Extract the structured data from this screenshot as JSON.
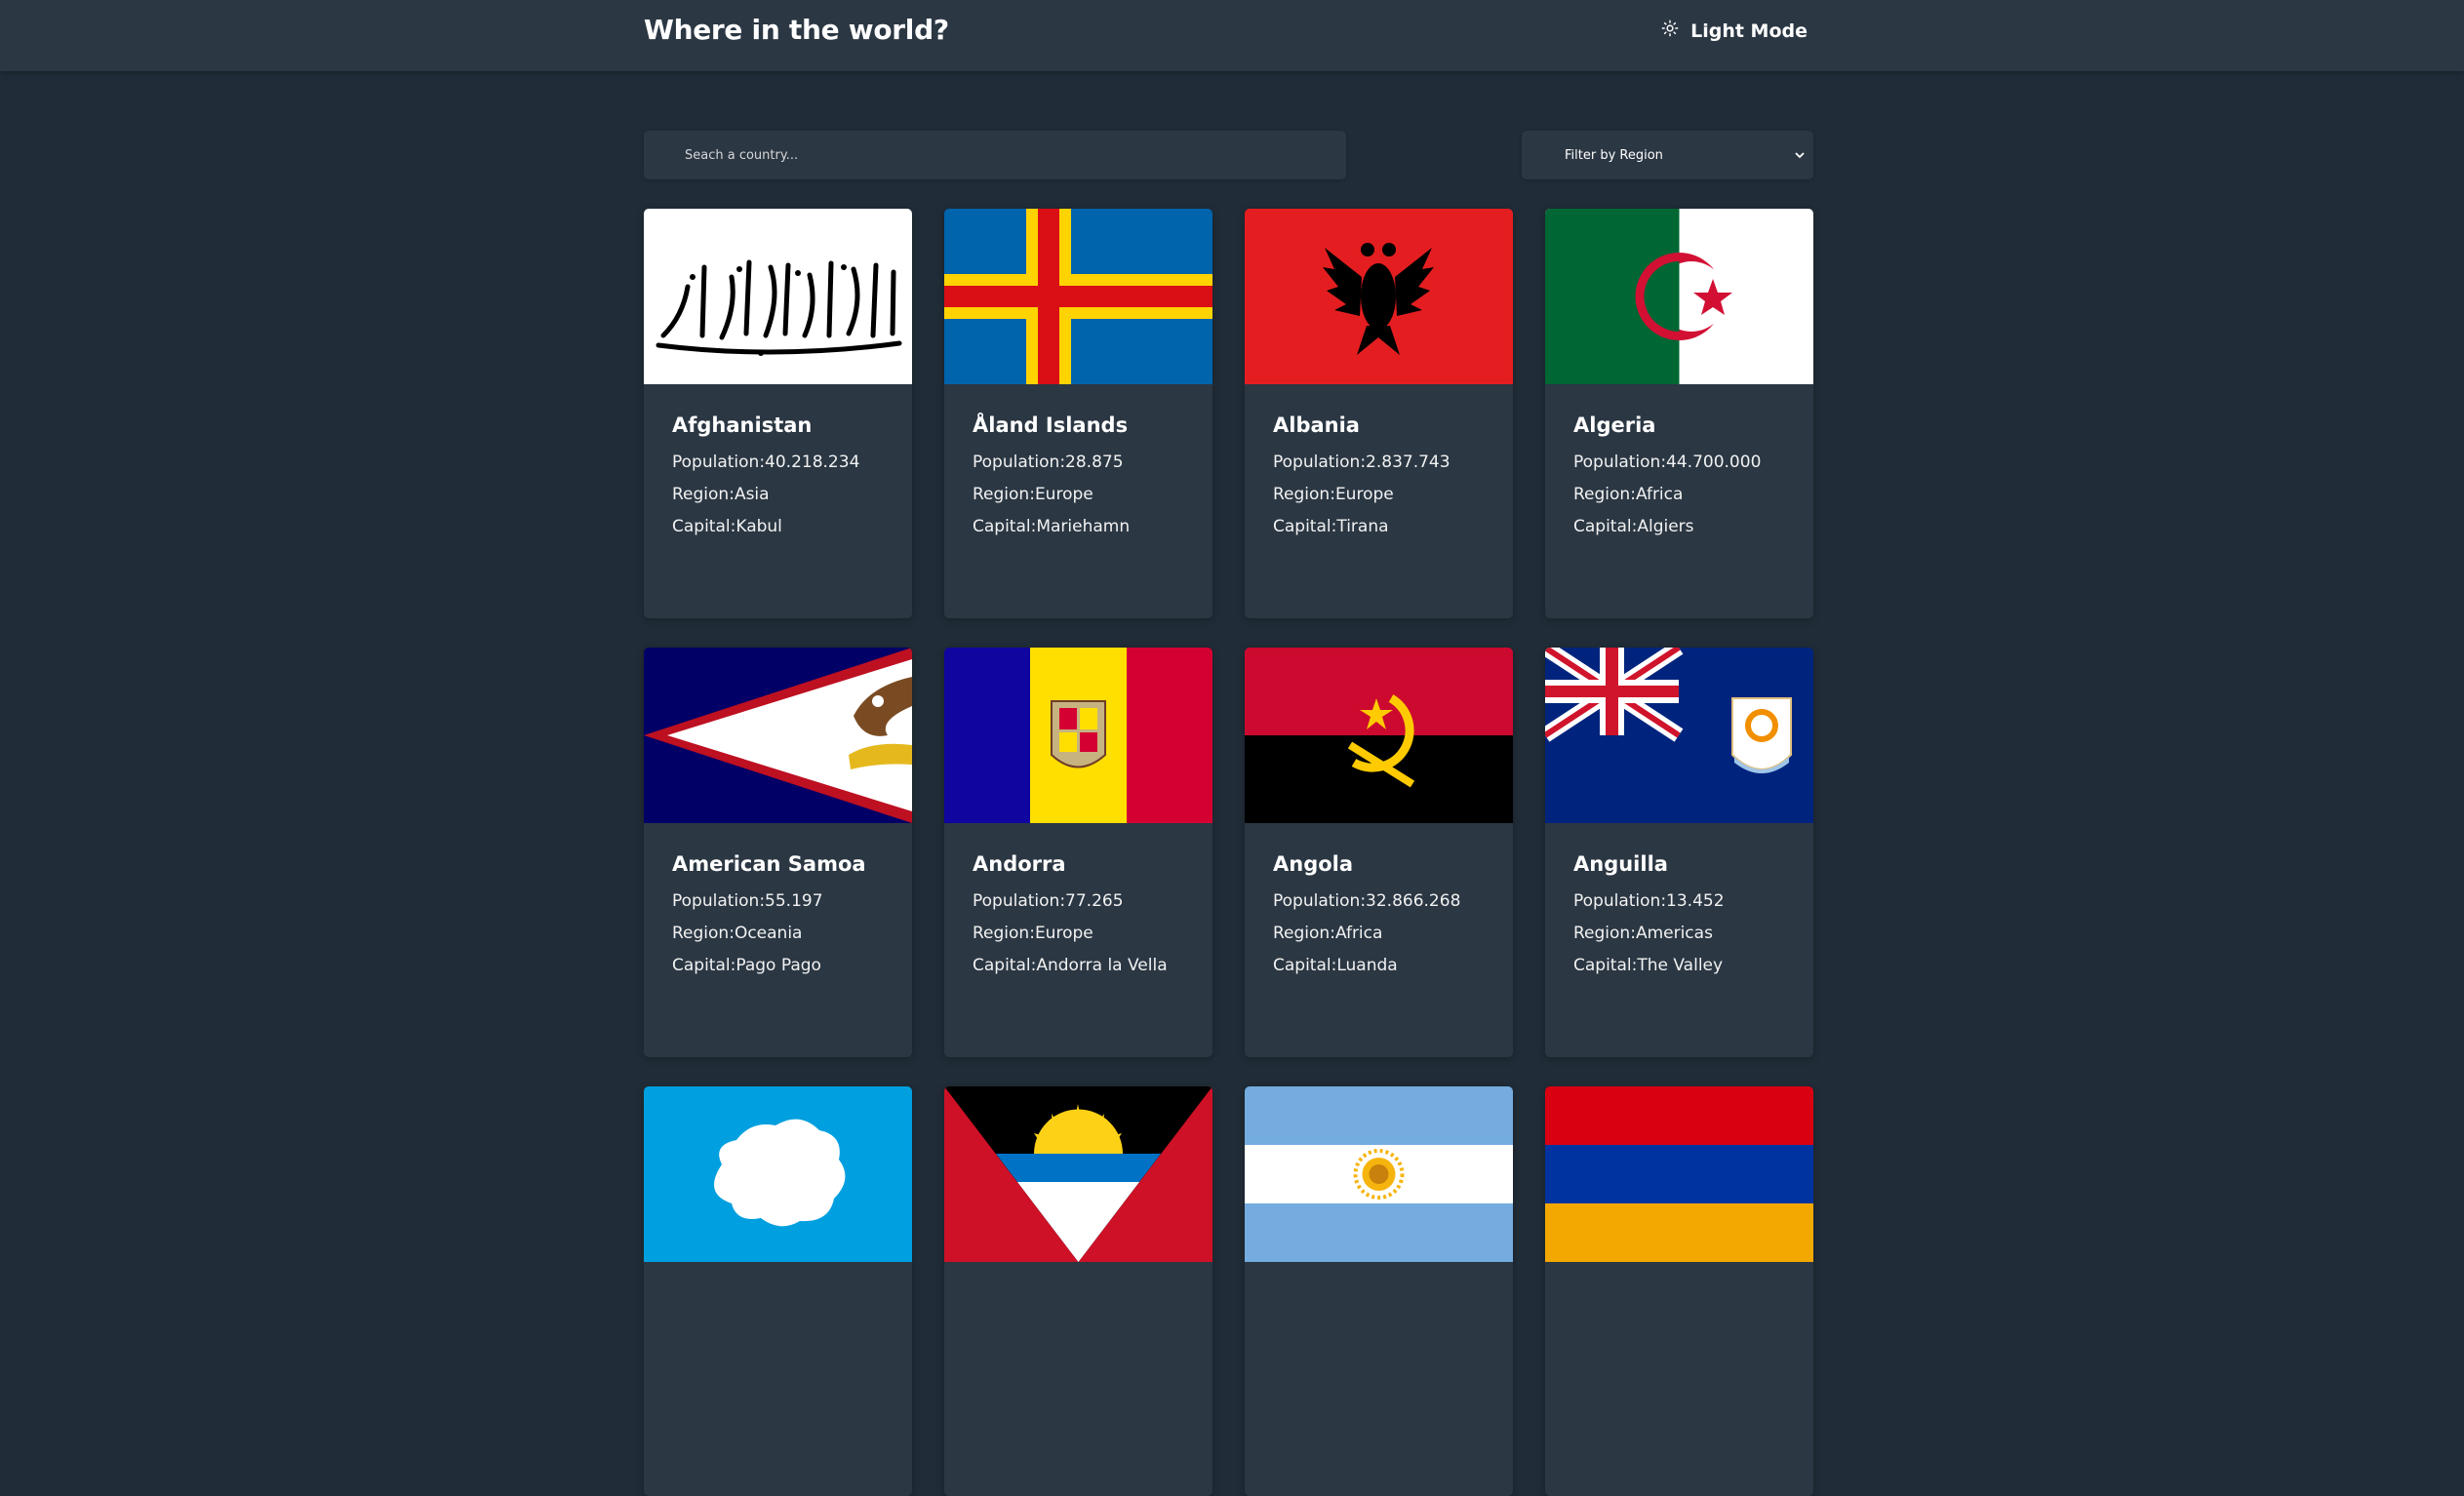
{
  "header": {
    "title": "Where in the world?",
    "theme_toggle": {
      "label": "Light Mode",
      "icon": "sun-icon"
    }
  },
  "search": {
    "placeholder": "Seach a country...",
    "value": "",
    "icon": "search-icon"
  },
  "filter": {
    "label": "Filter by Region",
    "icon": "chevron-down-icon"
  },
  "labels": {
    "population": "Population:",
    "region": "Region:",
    "capital": "Capital:"
  },
  "countries": [
    {
      "name": "Afghanistan",
      "population": "40.218.234",
      "region": "Asia",
      "capital": "Kabul"
    },
    {
      "name": "Åland Islands",
      "population": "28.875",
      "region": "Europe",
      "capital": "Mariehamn"
    },
    {
      "name": "Albania",
      "population": "2.837.743",
      "region": "Europe",
      "capital": "Tirana"
    },
    {
      "name": "Algeria",
      "population": "44.700.000",
      "region": "Africa",
      "capital": "Algiers"
    },
    {
      "name": "American Samoa",
      "population": "55.197",
      "region": "Oceania",
      "capital": "Pago Pago"
    },
    {
      "name": "Andorra",
      "population": "77.265",
      "region": "Europe",
      "capital": "Andorra la Vella"
    },
    {
      "name": "Angola",
      "population": "32.866.268",
      "region": "Africa",
      "capital": "Luanda"
    },
    {
      "name": "Anguilla",
      "population": "13.452",
      "region": "Americas",
      "capital": "The Valley"
    },
    {
      "name": "",
      "population": "",
      "region": "",
      "capital": ""
    },
    {
      "name": "",
      "population": "",
      "region": "",
      "capital": ""
    },
    {
      "name": "",
      "population": "",
      "region": "",
      "capital": ""
    },
    {
      "name": "",
      "population": "",
      "region": "",
      "capital": ""
    }
  ],
  "colors": {
    "background": "#202c37",
    "element": "#2b3743",
    "text": "#ffffff"
  }
}
